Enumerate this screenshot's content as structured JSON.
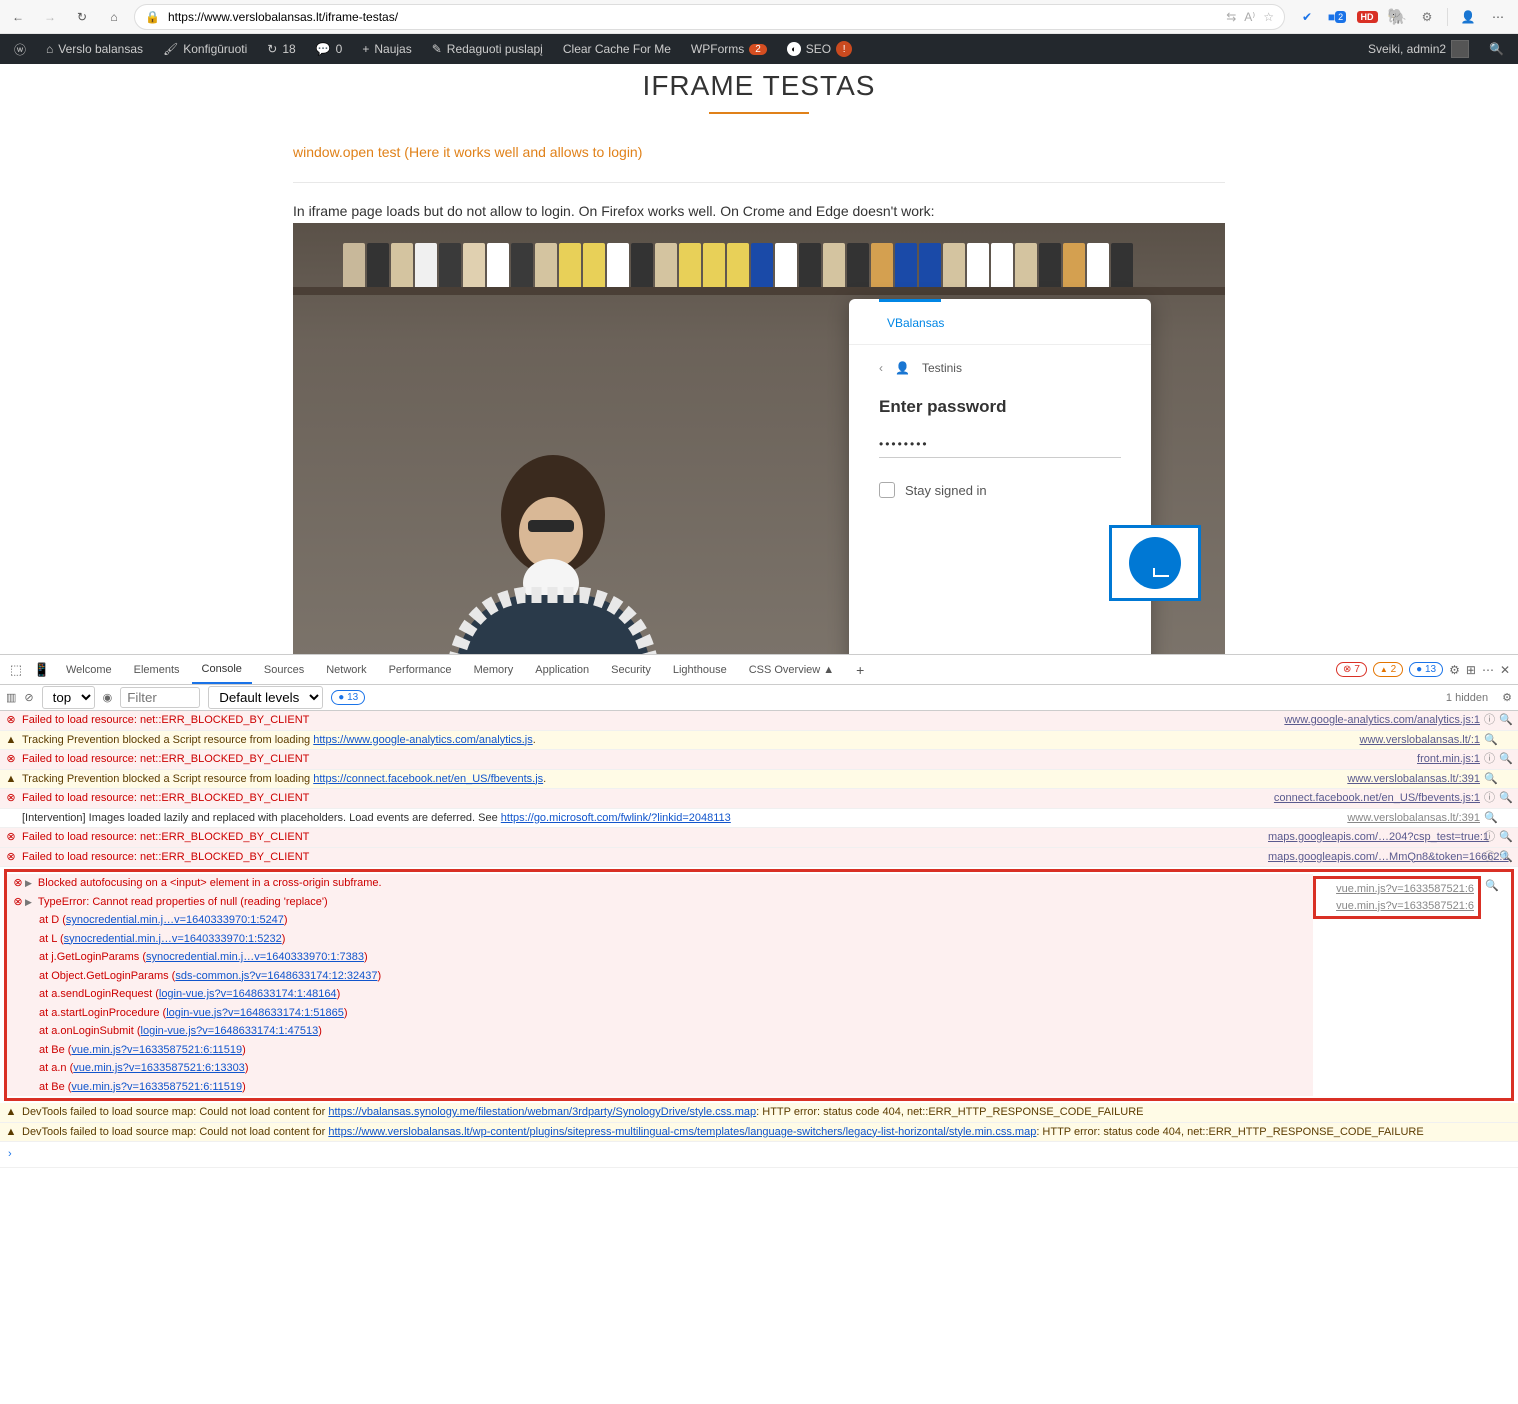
{
  "browser": {
    "url": "https://www.verslobalansas.lt/iframe-testas/",
    "icons": {
      "blue_badge": "2",
      "red_badge": "HD"
    }
  },
  "wpbar": {
    "site": "Verslo balansas",
    "configure": "Konfigūruoti",
    "updates": "18",
    "comments": "0",
    "new": "Naujas",
    "edit": "Redaguoti puslapį",
    "cache": "Clear Cache For Me",
    "wpforms": "WPForms",
    "wpforms_badge": "2",
    "seo": "SEO",
    "seo_badge": "!",
    "greeting": "Sveiki, admin2"
  },
  "page": {
    "title": "IFRAME TESTAS",
    "link": "window.open test (Here it works well and allows to login)",
    "desc": "In iframe page loads but do not allow to login. On Firefox works well. On Crome and Edge doesn't work:"
  },
  "login": {
    "tab": "VBalansas",
    "user": "Testinis",
    "heading": "Enter password",
    "pw": "••••••••",
    "stay": "Stay signed in"
  },
  "devtools": {
    "tabs": [
      "Welcome",
      "Elements",
      "Console",
      "Sources",
      "Network",
      "Performance",
      "Memory",
      "Application",
      "Security",
      "Lighthouse",
      "CSS Overview ▲"
    ],
    "errors": "7",
    "warnings": "2",
    "infos": "13",
    "filter_placeholder": "Filter",
    "levels": "Default levels",
    "top": "top",
    "issues": "13",
    "hidden": "1 hidden",
    "msgs": {
      "blocked": "Failed to load resource: net::ERR_BLOCKED_BY_CLIENT",
      "track1a": "Tracking Prevention blocked a Script resource from loading ",
      "track1b": "https://www.google-analytics.com/analytics.js",
      "track2b": "https://connect.facebook.net/en_US/fbevents.js",
      "interv_a": "[Intervention] Images loaded lazily and replaced with placeholders. Load events are deferred. See ",
      "interv_b": "https://go.microsoft.com/fwlink/?linkid=2048113",
      "autofocus": "Blocked autofocusing on a <input> element in a cross-origin subframe.",
      "typeerr": "TypeError: Cannot read properties of null (reading 'replace')",
      "st1a": "at D (",
      "st1b": "synocredential.min.j…v=1640333970:1:5247",
      "st2a": "at L (",
      "st2b": "synocredential.min.j…v=1640333970:1:5232",
      "st3a": "at j.GetLoginParams (",
      "st3b": "synocredential.min.j…v=1640333970:1:7383",
      "st4a": "at Object.GetLoginParams (",
      "st4b": "sds-common.js?v=1648633174:12:32437",
      "st5a": "at a.sendLoginRequest (",
      "st5b": "login-vue.js?v=1648633174:1:48164",
      "st6a": "at a.startLoginProcedure (",
      "st6b": "login-vue.js?v=1648633174:1:51865",
      "st7a": "at a.onLoginSubmit (",
      "st7b": "login-vue.js?v=1648633174:1:47513",
      "st8a": "at Be (",
      "st8b": "vue.min.js?v=1633587521:6:11519",
      "st9a": "at a.n (",
      "st9b": "vue.min.js?v=1633587521:6:13303",
      "st10a": "at Be (",
      "st10b": "vue.min.js?v=1633587521:6:11519",
      "dev1a": "DevTools failed to load source map: Could not load content for ",
      "dev1b": "https://vbalansas.synology.me/filestation/webman/3rdparty/SynologyDrive/style.css.map",
      "dev1c": ": HTTP error: status code 404, net::ERR_HTTP_RESPONSE_CODE_FAILURE",
      "dev2b": "https://www.verslobalansas.lt/wp-content/plugins/sitepress-multilingual-cms/templates/language-switchers/legacy-list-horizontal/style.min.css.map",
      "dev2c": ": HTTP error: status code 404, net::ERR_HTTP_RESPONSE_CODE_FAILURE"
    },
    "srcs": {
      "ga": "www.google-analytics.com/analytics.js:1",
      "vb1": "www.verslobalansas.lt/:1",
      "front": "front.min.js:1",
      "vb391": "www.verslobalansas.lt/:391",
      "fb": "connect.facebook.net/en_US/fbevents.js:1",
      "maps1": "maps.googleapis.com/…204?csp_test=true:1",
      "maps2": "maps.googleapis.com/…MmQn8&token=16662:1",
      "vue": "vue.min.js?v=1633587521:6"
    }
  }
}
